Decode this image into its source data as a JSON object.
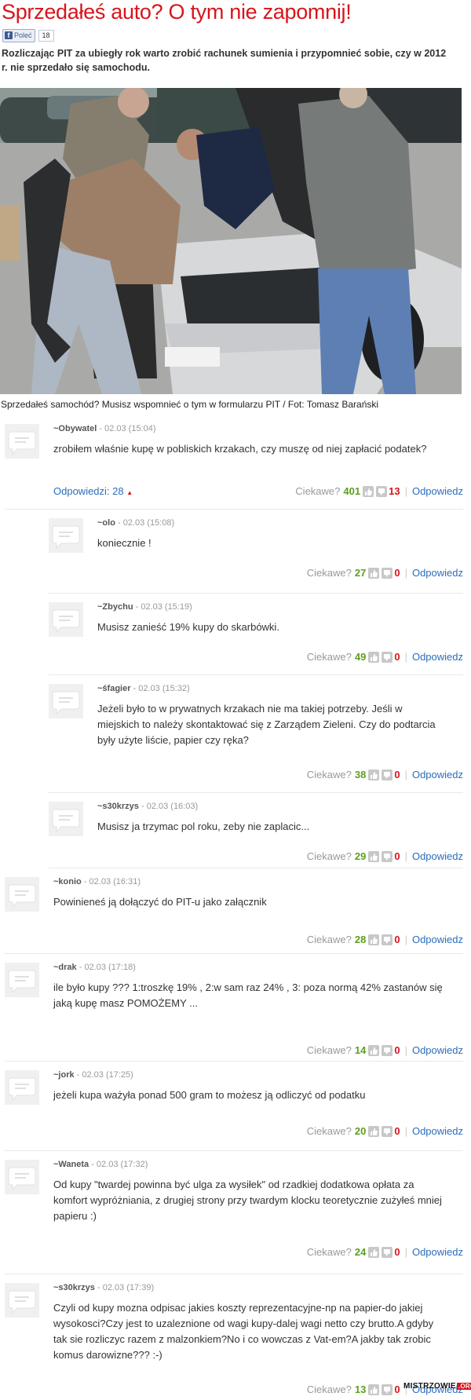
{
  "article": {
    "title": "Sprzedałeś auto? O tym nie zapomnij!",
    "fb_label": "Poleć",
    "fb_count": "18",
    "lead": "Rozliczając PIT za ubiegły rok warto zrobić rachunek sumienia i przypomnieć sobie, czy w 2012 r. nie sprzedało się samochodu.",
    "caption": "Sprzedałeś samochód? Musisz wspomnieć o tym w formularzu PIT / Fot: Tomasz Barański"
  },
  "labels": {
    "interesting": "Ciekawe?",
    "reply": "Odpowiedz",
    "replies_prefix": "Odpowiedzi: 28"
  },
  "comments": [
    {
      "author": "~Obywatel",
      "date": "- 02.03 (15:04)",
      "text": "zrobiłem właśnie kupę w pobliskich krzakach, czy muszę od niej zapłacić podatek?",
      "up": "401",
      "down": "13"
    },
    {
      "author": "~olo",
      "date": "- 02.03 (15:08)",
      "text": "koniecznie !",
      "up": "27",
      "down": "0"
    },
    {
      "author": "~Zbychu",
      "date": "- 02.03 (15:19)",
      "text": "Musisz zanieść 19% kupy do skarbówki.",
      "up": "49",
      "down": "0"
    },
    {
      "author": "~śfagier",
      "date": "- 02.03 (15:32)",
      "text": "Jeżeli było to w prywatnych krzakach nie ma takiej potrzeby. Jeśli w miejskich to należy skontaktować się z Zarządem Zieleni. Czy do podtarcia były użyte liście, papier czy ręka?",
      "up": "38",
      "down": "0"
    },
    {
      "author": "~s30krzys",
      "date": "- 02.03 (16:03)",
      "text": "Musisz ja trzymac pol roku, zeby nie zaplacic...",
      "up": "29",
      "down": "0"
    },
    {
      "author": "~konio",
      "date": "- 02.03 (16:31)",
      "text": "Powinieneś ją dołączyć do PIT-u jako załącznik",
      "up": "28",
      "down": "0"
    },
    {
      "author": "~drak",
      "date": "- 02.03 (17:18)",
      "text": "ile było kupy ??? 1:troszkę 19% , 2:w sam raz 24% , 3: poza normą 42% zastanów się jaką kupę masz POMOŻEMY ...",
      "up": "14",
      "down": "0"
    },
    {
      "author": "~jork",
      "date": "- 02.03 (17:25)",
      "text": "jeżeli kupa ważyła ponad 500 gram to możesz ją odliczyć od podatku",
      "up": "20",
      "down": "0"
    },
    {
      "author": "~Waneta",
      "date": "- 02.03 (17:32)",
      "text": "Od kupy \"twardej powinna być ulga za wysiłek\" od rzadkiej dodatkowa opłata za komfort wypróżniania, z drugiej strony przy twardym klocku teoretycznie zużyłeś mniej papieru :)",
      "up": "24",
      "down": "0"
    },
    {
      "author": "~s30krzys",
      "date": "- 02.03 (17:39)",
      "text": "Czyli od kupy mozna odpisac jakies koszty reprezentacyjne-np na papier-do jakiej wysokosci?Czy jest to uzaleznione od wagi kupy-dalej wagi netto czy brutto.A gdyby tak sie rozliczyc razem z malzonkiem?No i co wowczas z Vat-em?A jakby tak zrobic komus darowizne??? :-)",
      "up": "13",
      "down": "0"
    }
  ],
  "watermark": {
    "name": "MISTRZOWIE",
    "tld": ".ORG"
  },
  "colors": {
    "title": "#d8141c",
    "link": "#2a6ebb",
    "up": "#5ba01b",
    "down": "#d8141c"
  }
}
